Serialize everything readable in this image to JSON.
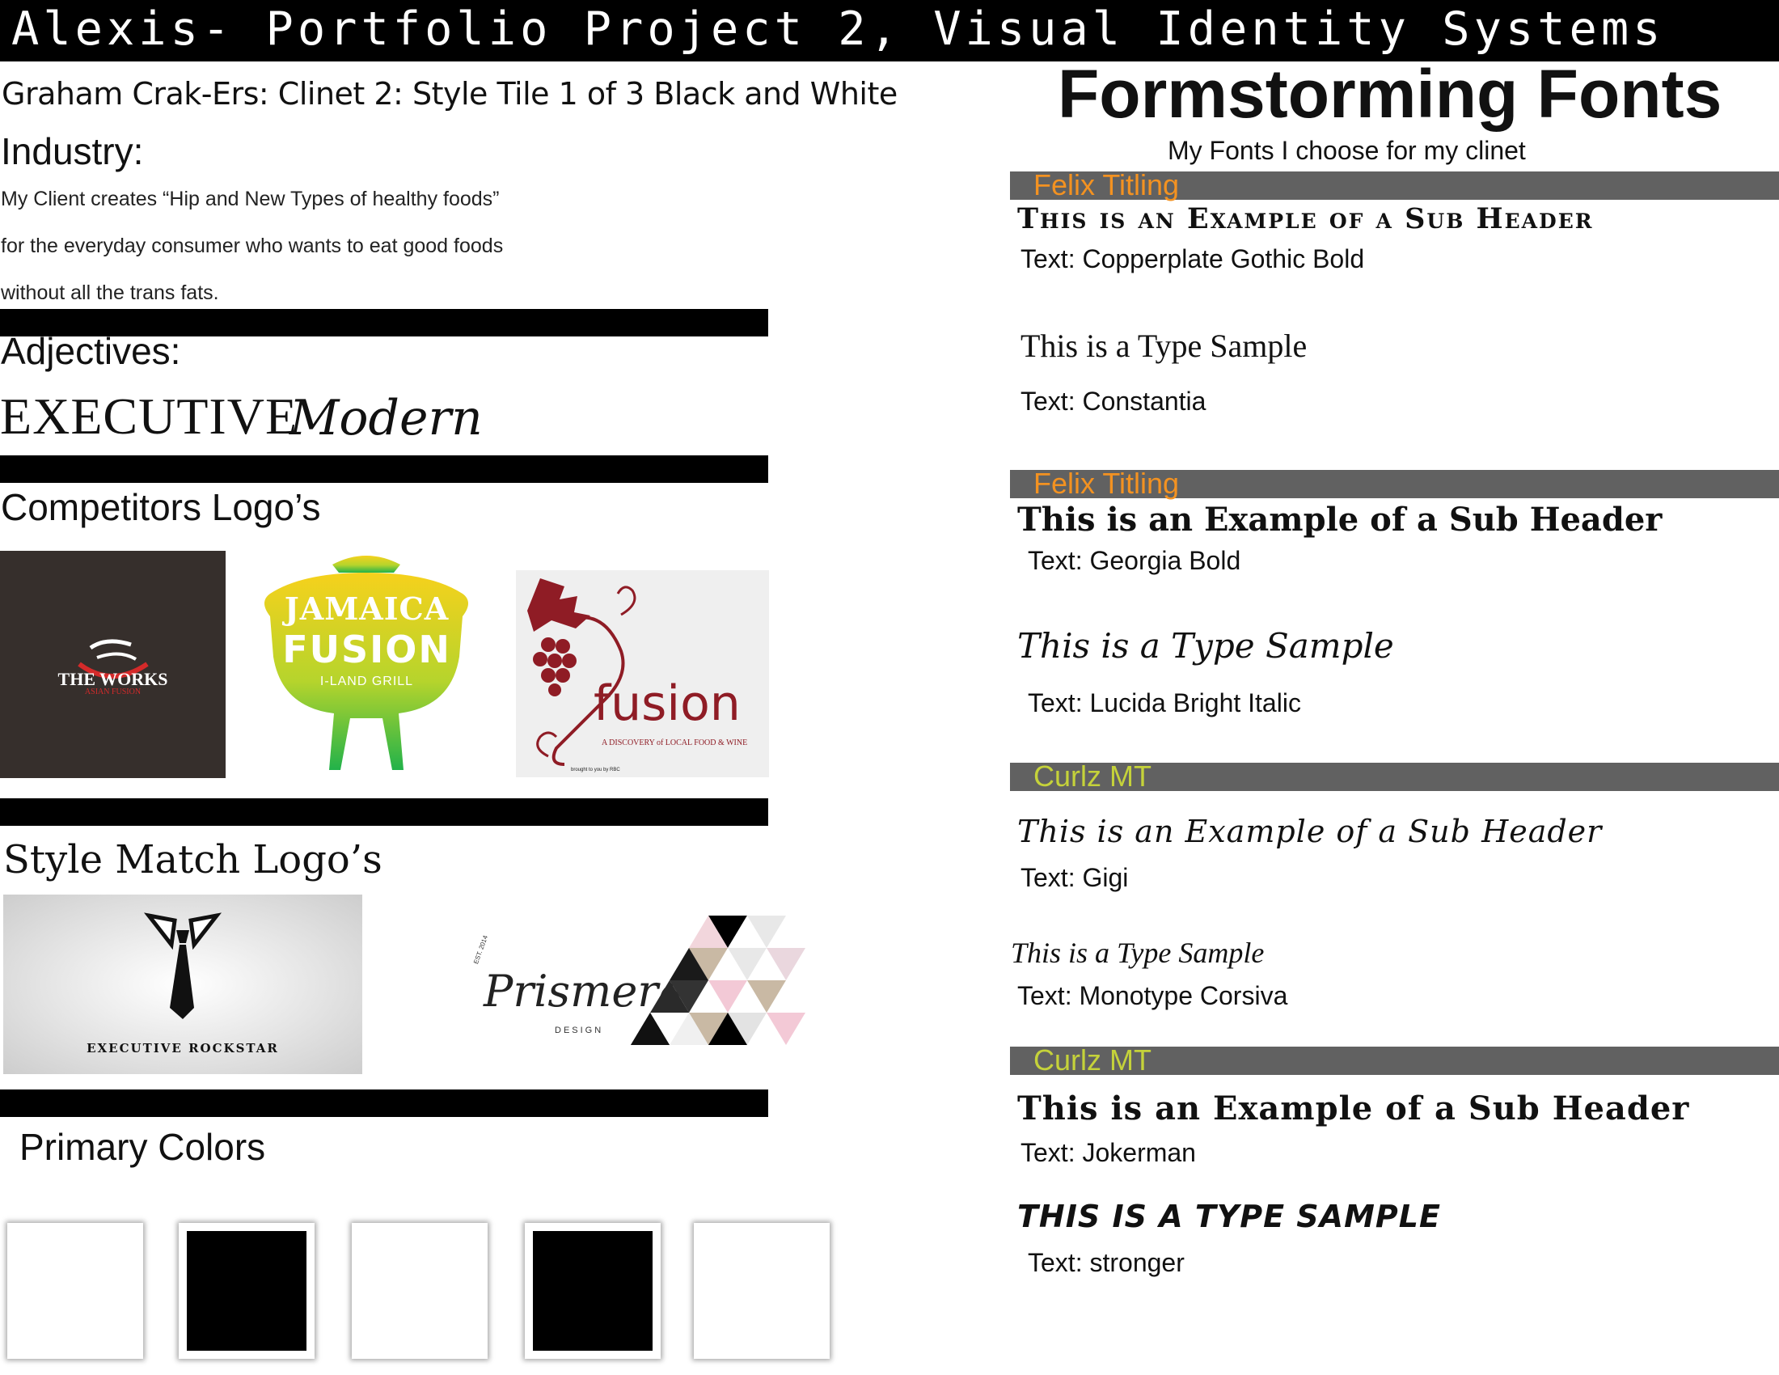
{
  "header": {
    "title": "Alexis- Portfolio Project 2, Visual Identity Systems"
  },
  "left": {
    "subtitle": "Graham Crak-Ers: Clinet 2: Style Tile 1 of 3 Black and White",
    "industry_heading": "Industry:",
    "industry_lines": [
      "My Client creates “Hip and New Types of healthy foods”",
      "for the everyday consumer who wants to eat good foods",
      "without all the trans fats."
    ],
    "adjectives_heading": "Adjectives:",
    "adjectives": [
      "EXECUTIVE",
      "Modern"
    ],
    "competitors_heading": "Competitors Logo’s",
    "competitor_logos": {
      "works": {
        "name": "THE WORKS",
        "tagline": "ASIAN FUSION"
      },
      "jamaica": {
        "line1": "JAMAICA",
        "line2": "FUSION",
        "line3": "I-LAND GRILL"
      },
      "fusion": {
        "word": "fusion",
        "tagline": "A DISCOVERY of LOCAL FOOD & WINE",
        "credit": "brought to you by RBC"
      }
    },
    "style_match_heading": "Style Match Logo’s",
    "style_logos": {
      "rockstar": "EXECUTIVE ROCKSTAR",
      "primera": {
        "word": "Prismera",
        "sub": "DESIGN",
        "est": "EST. 2014"
      }
    },
    "colors_heading": "Primary Colors",
    "primary_colors": [
      "#ffffff",
      "#000000",
      "#ffffff",
      "#000000",
      "#ffffff"
    ]
  },
  "right": {
    "title": "Formstorming Fonts",
    "subtitle": "My Fonts I choose for my clinet",
    "sections": [
      {
        "bar_label": "Felix Titling",
        "bar_color": "#f39221",
        "subheader": "This is an Example of a Sub Header",
        "subheader_note": "Text: Copperplate Gothic Bold",
        "sample": "This is a Type Sample",
        "sample_note": "Text: Constantia"
      },
      {
        "bar_label": "Felix Titling",
        "bar_color": "#f39221",
        "subheader": "This is an Example of a Sub Header",
        "subheader_note": "Text: Georgia Bold",
        "sample": "This is a Type Sample",
        "sample_note": "Text: Lucida Bright Italic"
      },
      {
        "bar_label": "Curlz MT",
        "bar_color": "#c5d23a",
        "subheader": "This is an Example of a Sub Header",
        "subheader_note": "Text: Gigi",
        "sample": "This is a Type Sample",
        "sample_note": "Text: Monotype Corsiva"
      },
      {
        "bar_label": "Curlz MT",
        "bar_color": "#c5d23a",
        "subheader": "This is an Example of a Sub Header",
        "subheader_note": "Text: Jokerman",
        "sample": "THIS IS A TYPE SAMPLE",
        "sample_note": "Text: stronger"
      }
    ]
  }
}
